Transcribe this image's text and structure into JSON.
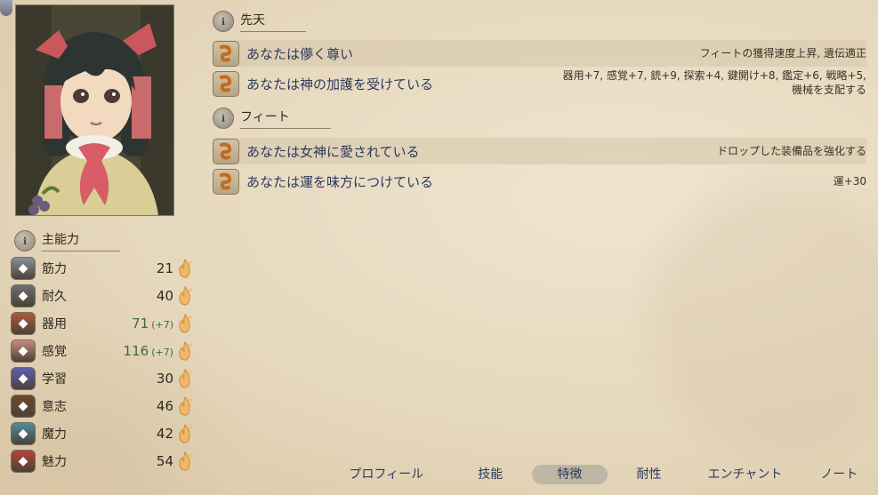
{
  "portrait": {
    "alt": "character portrait"
  },
  "stats": {
    "header": "主能力",
    "items": [
      {
        "name": "筋力",
        "value": "21",
        "bonus": "",
        "icon": "crossed-swords-icon",
        "color": "#8a8f9c"
      },
      {
        "name": "耐久",
        "value": "40",
        "bonus": "",
        "icon": "armor-icon",
        "color": "#6e6e74"
      },
      {
        "name": "器用",
        "value": "71",
        "bonus": "(+7)",
        "icon": "dexterity-icon",
        "color": "#b05a3a"
      },
      {
        "name": "感覚",
        "value": "116",
        "bonus": "(+7)",
        "icon": "perception-icon",
        "color": "#c98a7e"
      },
      {
        "name": "学習",
        "value": "30",
        "bonus": "",
        "icon": "book-icon",
        "color": "#5e5fb0"
      },
      {
        "name": "意志",
        "value": "46",
        "bonus": "",
        "icon": "shield-icon",
        "color": "#6d4a2f"
      },
      {
        "name": "魔力",
        "value": "42",
        "bonus": "",
        "icon": "magic-icon",
        "color": "#4f8aa0"
      },
      {
        "name": "魅力",
        "value": "54",
        "bonus": "",
        "icon": "ribbon-icon",
        "color": "#b8423a"
      }
    ]
  },
  "innate": {
    "header": "先天",
    "items": [
      {
        "name": "あなたは儚く尊い",
        "desc": "フィートの獲得速度上昇, 遺伝適正"
      },
      {
        "name": "あなたは神の加護を受けている",
        "desc": "器用+7, 感覚+7, 銃+9, 探索+4, 鍵開け+8, 鑑定+6, 戦略+5,",
        "desc2": "機械を支配する"
      }
    ]
  },
  "feats": {
    "header": "フィート",
    "items": [
      {
        "name": "あなたは女神に愛されている",
        "desc": "ドロップした装備品を強化する"
      },
      {
        "name": "あなたは運を味方につけている",
        "desc": "運+30"
      }
    ]
  },
  "tabs": [
    {
      "label": "プロフィール",
      "active": false
    },
    {
      "label": "技能",
      "active": false
    },
    {
      "label": "特徴",
      "active": true
    },
    {
      "label": "耐性",
      "active": false
    },
    {
      "label": "エンチャント",
      "active": false
    },
    {
      "label": "ノート",
      "active": false
    }
  ],
  "colors": {
    "accent_text": "#2d3a5c",
    "bonus_green": "#3e6b3a",
    "parchment": "#e6d8bd"
  }
}
